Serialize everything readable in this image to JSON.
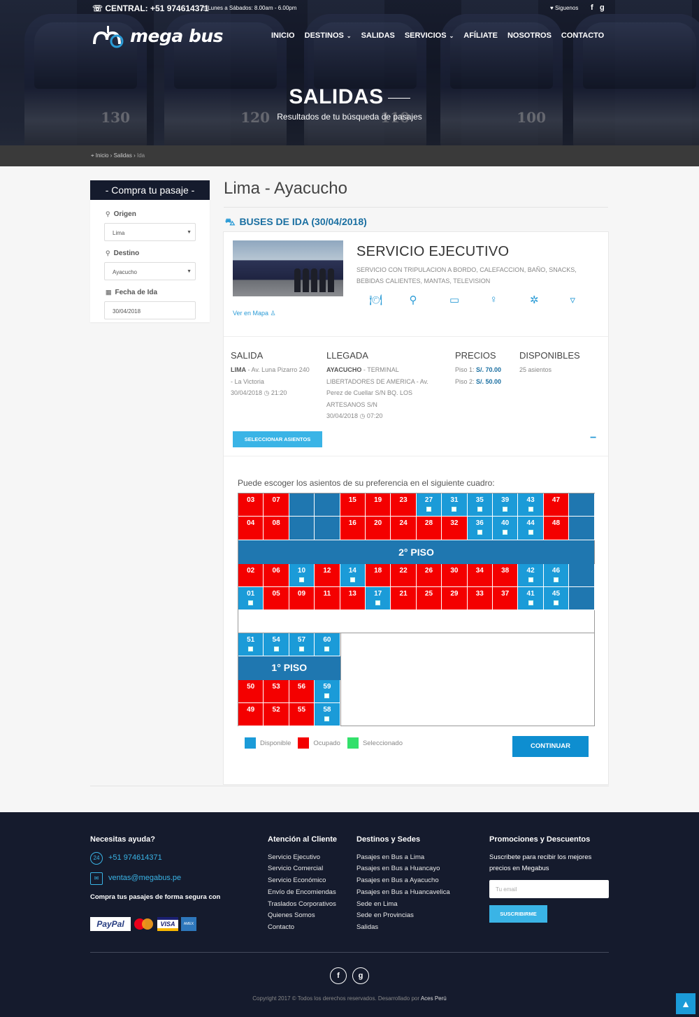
{
  "topbar": {
    "phone": "☏ CENTRAL: +51 974614371",
    "hours": "◷ Lunes a Sábados: 8.00am - 6.00pm",
    "follow": "♥ Siguenos",
    "facebook": "f",
    "google": "g"
  },
  "brand": {
    "name": "mega bus"
  },
  "nav": [
    {
      "label": "INICIO",
      "dropdown": false
    },
    {
      "label": "DESTINOS",
      "dropdown": true
    },
    {
      "label": "SALIDAS",
      "dropdown": false
    },
    {
      "label": "SERVICIOS",
      "dropdown": true
    },
    {
      "label": "AFÍLIATE",
      "dropdown": false
    },
    {
      "label": "NOSOTROS",
      "dropdown": false
    },
    {
      "label": "CONTACTO",
      "dropdown": false
    }
  ],
  "hero": {
    "title": "SALIDAS",
    "subtitle": "Resultados de tu búsqueda de pasajes",
    "bus_numbers": [
      "130",
      "120",
      "110",
      "100"
    ]
  },
  "breadcrumb": {
    "home": "Inicio",
    "section": "Salidas",
    "current": "Ida",
    "sep": "›"
  },
  "sidebar": {
    "title": "- Compra tu pasaje -",
    "origen_label": "Origen",
    "origen_value": "Lima",
    "destino_label": "Destino",
    "destino_value": "Ayacucho",
    "fecha_label": "Fecha de Ida",
    "fecha_value": "30/04/2018"
  },
  "route": {
    "title": "Lima - Ayacucho",
    "buses_label": "BUSES DE IDA (30/04/2018)"
  },
  "service": {
    "title": "SERVICIO EJECUTIVO",
    "description": "SERVICIO CON TRIPULACION A BORDO, CALEFACCION, BAÑO, SNACKS, BEBIDAS CALIENTES, MANTAS, TELEVISION",
    "map_link": "Ver en Mapa ♙",
    "amenity_icons": [
      "meal-icon",
      "location-pin-icon",
      "tv-icon",
      "attendant-icon",
      "heating-icon",
      "waste-bin-icon"
    ]
  },
  "trip": {
    "salida_head": "SALIDA",
    "salida_city": "LIMA",
    "salida_addr": " - Av. Luna Pizarro 240 - La Victoria",
    "salida_time": "30/04/2018 ◷ 21:20",
    "llegada_head": "LLEGADA",
    "llegada_city": "AYACUCHO",
    "llegada_addr": " - TERMINAL LIBERTADORES DE AMERICA - Av. Perez de Cuellar S/N BQ. LOS ARTESANOS S/N",
    "llegada_time": "30/04/2018 ◷ 07:20",
    "precios_head": "PRECIOS",
    "piso1_label": "Piso 1: ",
    "piso1_price": "S/. 70.00",
    "piso2_label": "Piso 2: ",
    "piso2_price": "S/. 50.00",
    "disp_head": "DISPONIBLES",
    "disp_value": "25 asientos",
    "select_button": "SELECCIONAR ASIENTOS",
    "collapse": "−"
  },
  "seats": {
    "intro": "Puede escoger los asientos de su preferencia en el siguiente cuadro:",
    "piso2_label": "2° PISO",
    "piso1_label": "1° PISO",
    "piso2_row1": [
      [
        "03",
        "oc"
      ],
      [
        "07",
        "oc"
      ],
      [
        "",
        "bl"
      ],
      [
        "",
        "bl"
      ],
      [
        "15",
        "oc"
      ],
      [
        "19",
        "oc"
      ],
      [
        "23",
        "oc"
      ],
      [
        "27",
        "av"
      ],
      [
        "31",
        "av"
      ],
      [
        "35",
        "av"
      ],
      [
        "39",
        "av"
      ],
      [
        "43",
        "av"
      ],
      [
        "47",
        "oc"
      ],
      [
        "",
        "bl"
      ]
    ],
    "piso2_row2": [
      [
        "04",
        "oc"
      ],
      [
        "08",
        "oc"
      ],
      [
        "",
        "bl"
      ],
      [
        "",
        "bl"
      ],
      [
        "16",
        "oc"
      ],
      [
        "20",
        "oc"
      ],
      [
        "24",
        "oc"
      ],
      [
        "28",
        "oc"
      ],
      [
        "32",
        "oc"
      ],
      [
        "36",
        "av"
      ],
      [
        "40",
        "av"
      ],
      [
        "44",
        "av"
      ],
      [
        "48",
        "oc"
      ],
      [
        "",
        "bl"
      ]
    ],
    "piso2_row3": [
      [
        "02",
        "oc"
      ],
      [
        "06",
        "oc"
      ],
      [
        "10",
        "av"
      ],
      [
        "12",
        "oc"
      ],
      [
        "14",
        "av"
      ],
      [
        "18",
        "oc"
      ],
      [
        "22",
        "oc"
      ],
      [
        "26",
        "oc"
      ],
      [
        "30",
        "oc"
      ],
      [
        "34",
        "oc"
      ],
      [
        "38",
        "oc"
      ],
      [
        "42",
        "av"
      ],
      [
        "46",
        "av"
      ],
      [
        "",
        "bl"
      ]
    ],
    "piso2_row4": [
      [
        "01",
        "av"
      ],
      [
        "05",
        "oc"
      ],
      [
        "09",
        "oc"
      ],
      [
        "11",
        "oc"
      ],
      [
        "13",
        "oc"
      ],
      [
        "17",
        "av"
      ],
      [
        "21",
        "oc"
      ],
      [
        "25",
        "oc"
      ],
      [
        "29",
        "oc"
      ],
      [
        "33",
        "oc"
      ],
      [
        "37",
        "oc"
      ],
      [
        "41",
        "av"
      ],
      [
        "45",
        "av"
      ],
      [
        "",
        "bl"
      ]
    ],
    "piso1_top": [
      [
        "51",
        "av"
      ],
      [
        "54",
        "av"
      ],
      [
        "57",
        "av"
      ],
      [
        "60",
        "av"
      ]
    ],
    "piso1_row1": [
      [
        "50",
        "oc"
      ],
      [
        "53",
        "oc"
      ],
      [
        "56",
        "oc"
      ],
      [
        "59",
        "av"
      ]
    ],
    "piso1_row2": [
      [
        "49",
        "oc"
      ],
      [
        "52",
        "oc"
      ],
      [
        "55",
        "oc"
      ],
      [
        "58",
        "av"
      ]
    ],
    "legend": [
      {
        "label": "Disponible",
        "color": "#1b9bd8"
      },
      {
        "label": "Ocupado",
        "color": "#f40000"
      },
      {
        "label": "Seleccionado",
        "color": "#33e06b"
      }
    ],
    "continue_button": "CONTINUAR"
  },
  "footer": {
    "help_title": "Necesitas ayuda?",
    "phone": "+51 974614371",
    "email": "ventas@megabus.pe",
    "secure_text": "Compra tus pasajes de forma segura con",
    "payments": {
      "paypal": "PayPal",
      "mastercard": "MasterCard",
      "visa": "VISA",
      "amex": "AMEX"
    },
    "atencion_title": "Atención al Cliente",
    "atencion_links": [
      "Servicio Ejecutivo",
      "Servicio Comercial",
      "Servicio Económico",
      "Envío de Encomiendas",
      "Traslados Corporativos",
      "Quienes Somos",
      "Contacto"
    ],
    "destinos_title": "Destinos y Sedes",
    "destinos_links": [
      "Pasajes en Bus a Lima",
      "Pasajes en Bus a Huancayo",
      "Pasajes en Bus a Ayacucho",
      "Pasajes en Bus a Huancavelica",
      "Sede en Lima",
      "Sede en Provincias",
      "Salidas"
    ],
    "promo_title": "Promociones y Descuentos",
    "promo_text": "Suscribete para recibir los mejores precios en Megabus",
    "email_placeholder": "Tu email",
    "subscribe_button": "SUSCRIBIRME",
    "copyright": "Copyright 2017 © Todos los derechos reservados. Desarrollado por ",
    "developer": "Aces Perú"
  },
  "to_top": "▲"
}
